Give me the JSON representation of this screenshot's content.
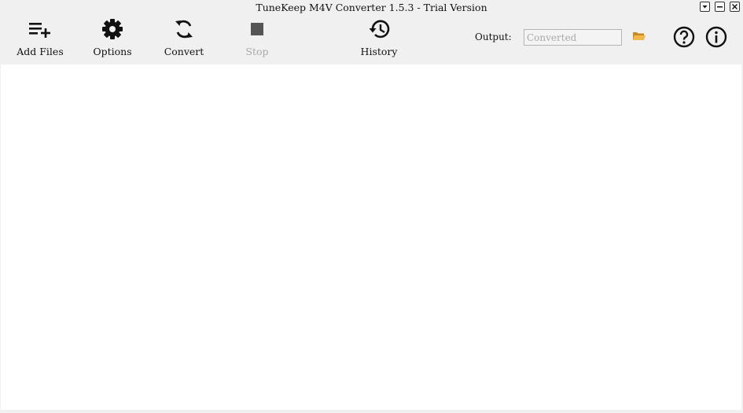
{
  "window": {
    "title": "TuneKeep M4V Converter 1.5.3 - Trial Version"
  },
  "toolbar": {
    "add_files": {
      "label": "Add Files",
      "icon": "playlist-add-icon"
    },
    "options": {
      "label": "Options",
      "icon": "gear-icon"
    },
    "convert": {
      "label": "Convert",
      "icon": "refresh-icon"
    },
    "stop": {
      "label": "Stop",
      "icon": "stop-icon",
      "disabled": true
    },
    "history": {
      "label": "History",
      "icon": "history-icon"
    }
  },
  "output": {
    "label": "Output:",
    "placeholder": "Converted"
  },
  "colors": {
    "background": "#f0f0f0",
    "content": "#ffffff",
    "disabled_text": "#a8a8a8",
    "folder": "#e6a030"
  }
}
